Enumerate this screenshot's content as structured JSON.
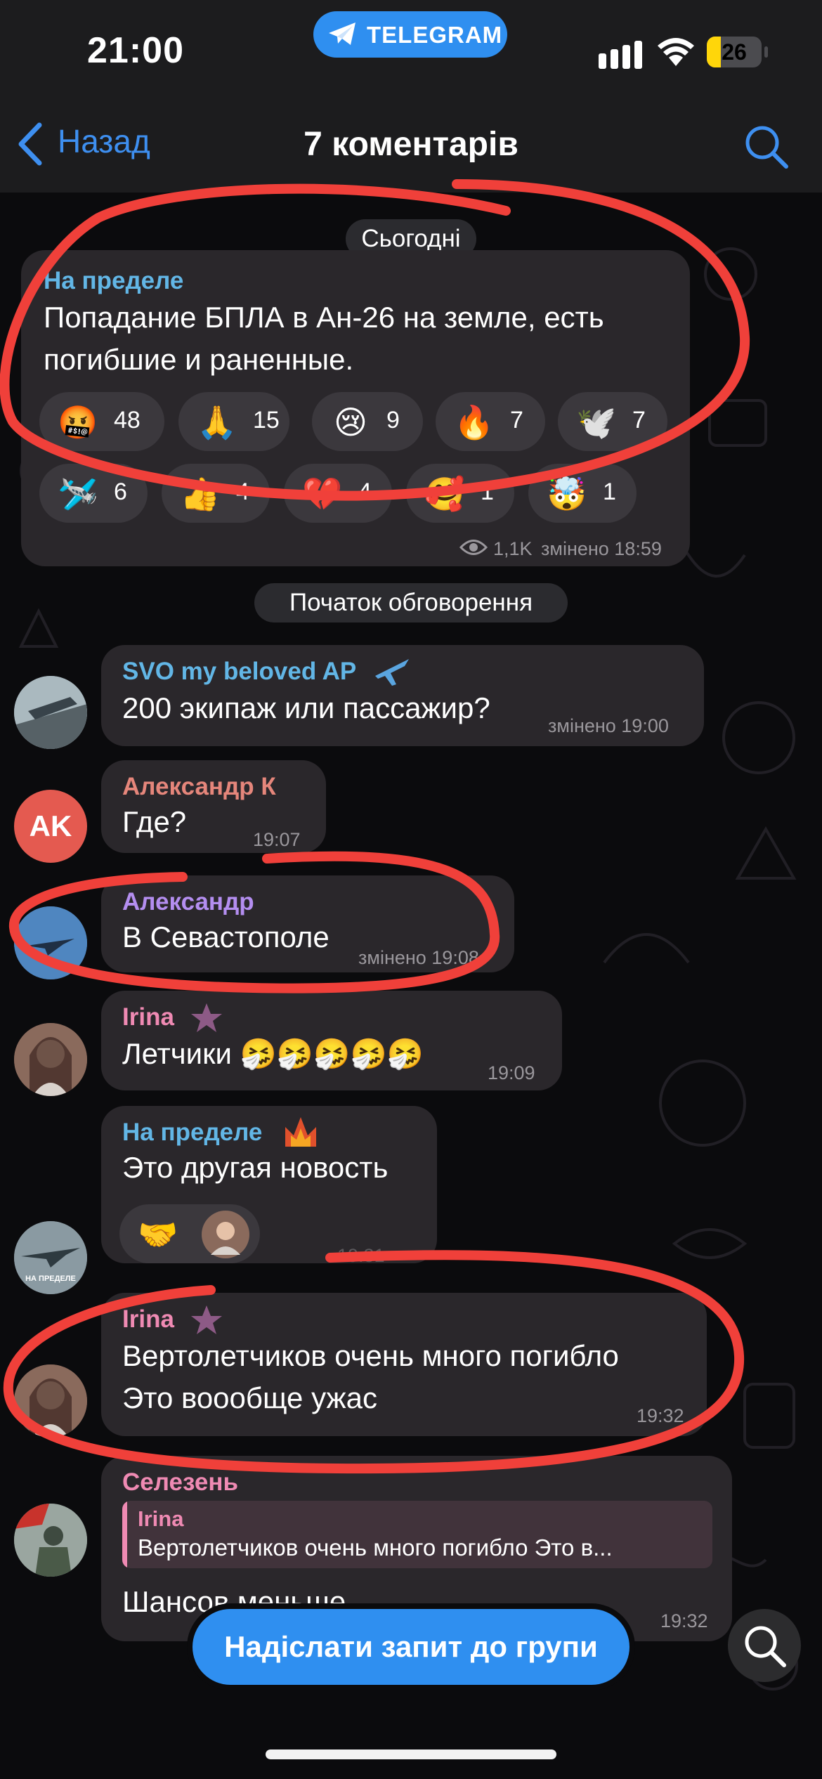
{
  "status_bar": {
    "time": "21:00",
    "app_pill": "TELEGRAM",
    "battery_level": "26",
    "battery_fraction": 0.26
  },
  "nav": {
    "back_label": "Назад",
    "title": "7 коментарів"
  },
  "date_separator": "Сьогодні",
  "post": {
    "author": "На пределе",
    "text_line1": "Попадание БПЛА в Ан-26 на земле, есть",
    "text_line2": "погибшие и раненные.",
    "reactions": [
      {
        "icon": "angry-cursing-face-icon",
        "emoji": "🤬",
        "count": "48"
      },
      {
        "icon": "folded-hands-icon",
        "emoji": "🙏",
        "count": "15"
      },
      {
        "icon": "crying-face-icon",
        "emoji": "😢",
        "count": "9"
      },
      {
        "icon": "fire-icon",
        "emoji": "🔥",
        "count": "7"
      },
      {
        "icon": "dove-icon",
        "emoji": "🕊️",
        "count": "7"
      },
      {
        "icon": "jet-sticker-icon",
        "emoji": "🛩️",
        "count": "6"
      },
      {
        "icon": "thumbs-up-icon",
        "emoji": "👍",
        "count": "4"
      },
      {
        "icon": "broken-heart-icon",
        "emoji": "💔",
        "count": "4"
      },
      {
        "icon": "smiling-face-with-hearts-icon",
        "emoji": "🥰",
        "count": "1"
      },
      {
        "icon": "exploding-head-icon",
        "emoji": "🤯",
        "count": "1"
      }
    ],
    "views": "1,1K",
    "meta": "змінено 18:59"
  },
  "discussion_separator": "Початок обговорення",
  "messages": [
    {
      "author": "SVO my beloved AP",
      "text": "200 экипаж или пассажир?",
      "time": "змінено 19:00",
      "author_color": "#62b6e6"
    },
    {
      "author": "Александр К",
      "text": "Где?",
      "time": "19:07",
      "author_color": "#e5867b",
      "avatar_initials": "AK",
      "avatar_color": "#e45a50"
    },
    {
      "author": "Александр",
      "text": "В Севастополе",
      "time": "змінено 19:08",
      "author_color": "#b48ef0"
    },
    {
      "author": "Irina",
      "text": "Летчики 🤧🤧🤧🤧🤧",
      "time": "19:09",
      "author_color": "#ef8ab3"
    },
    {
      "author": "На пределе",
      "text": "Это другая новость",
      "time": "19:31",
      "author_color": "#62b6e6",
      "avatar_caption": "НА ПРЕДЕЛЕ",
      "reaction_emoji": "🤝"
    },
    {
      "author": "Irina",
      "text_line1": "Вертолетчиков очень много погибло",
      "text_line2": "Это воообще  ужас",
      "time": "19:32",
      "author_color": "#ef8ab3"
    },
    {
      "author": "Селезень",
      "reply_author": "Irina",
      "reply_text": "Вертолетчиков очень много погибло Это в...",
      "text": "Шансов меньше",
      "time": "19:32",
      "author_color": "#ef8ab3"
    }
  ],
  "bottom_button": "Надіслати запит до групи",
  "colors": {
    "accent": "#2f8ff0",
    "link": "#3e8ff0",
    "bubble": "#2a272b",
    "annotation_red": "#f0403a"
  }
}
